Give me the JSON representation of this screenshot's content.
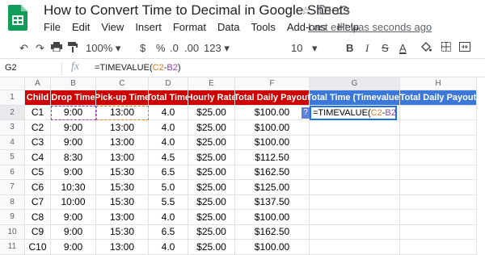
{
  "header": {
    "title": "How to Convert Time to Decimal in Google Sheets",
    "menu": [
      "File",
      "Edit",
      "View",
      "Insert",
      "Format",
      "Data",
      "Tools",
      "Add-ons",
      "Help"
    ],
    "last_edit": "Last edit was seconds ago"
  },
  "toolbar": {
    "zoom": "100%",
    "currency": "$",
    "percent": "%",
    "dec_less": ".0",
    "dec_more": ".00",
    "more_formats": "123",
    "font_size": "10",
    "bold": "B",
    "italic": "I",
    "strike": "S",
    "text_color": "A"
  },
  "formula_bar": {
    "name_box": "G2",
    "fx": "fx",
    "formula_prefix": "=TIMEVALUE(",
    "ref1": "C2",
    "minus": "-",
    "ref2": "B2",
    "formula_suffix": ")"
  },
  "columns": [
    "A",
    "B",
    "C",
    "D",
    "E",
    "F",
    "G",
    "H"
  ],
  "header_row": [
    "Child",
    "Drop Time",
    "Pick-up Time",
    "Total Time",
    "Hourly Rate",
    "Total Daily Payout",
    "Total Time (Timevalue)",
    "Total Daily Payout"
  ],
  "rows": [
    {
      "n": "2",
      "cells": [
        "C1",
        "9:00",
        "13:00",
        "4.0",
        "$25.00",
        "$100.00"
      ]
    },
    {
      "n": "3",
      "cells": [
        "C2",
        "9:00",
        "13:00",
        "4.0",
        "$25.00",
        "$100.00"
      ]
    },
    {
      "n": "4",
      "cells": [
        "C3",
        "9:00",
        "13:00",
        "4.0",
        "$25.00",
        "$100.00"
      ]
    },
    {
      "n": "5",
      "cells": [
        "C4",
        "8:30",
        "13:00",
        "4.5",
        "$25.00",
        "$112.50"
      ]
    },
    {
      "n": "6",
      "cells": [
        "C5",
        "9:00",
        "15:30",
        "6.5",
        "$25.00",
        "$162.50"
      ]
    },
    {
      "n": "7",
      "cells": [
        "C6",
        "10:30",
        "15:30",
        "5.0",
        "$25.00",
        "$125.00"
      ]
    },
    {
      "n": "8",
      "cells": [
        "C7",
        "10:00",
        "15:30",
        "5.5",
        "$25.00",
        "$137.50"
      ]
    },
    {
      "n": "9",
      "cells": [
        "C8",
        "9:00",
        "13:00",
        "4.0",
        "$25.00",
        "$100.00"
      ]
    },
    {
      "n": "10",
      "cells": [
        "C9",
        "9:00",
        "15:30",
        "6.5",
        "$25.00",
        "$162.50"
      ]
    },
    {
      "n": "11",
      "cells": [
        "C10",
        "9:00",
        "13:00",
        "4.0",
        "$25.00",
        "$100.00"
      ]
    }
  ],
  "help_marker": "?",
  "colors": {
    "header_red": "#cc0000",
    "header_blue": "#3c78d8",
    "ref_c": "#e67c1c",
    "ref_b": "#8e44ad",
    "sheets_green": "#0f9d58"
  }
}
